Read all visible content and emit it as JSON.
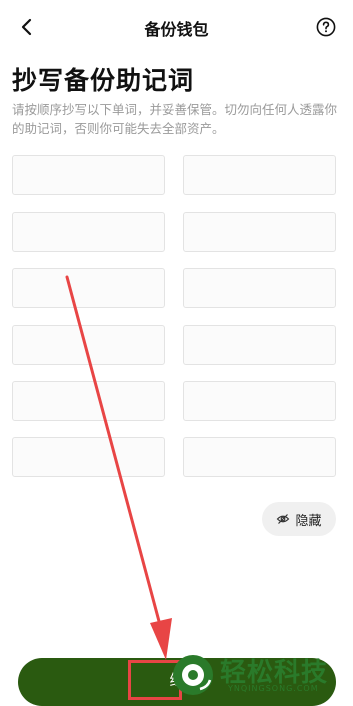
{
  "nav": {
    "title": "备份钱包"
  },
  "heading": "抄写备份助记词",
  "description": "请按顺序抄写以下单词，并妥善保管。切勿向任何人透露你的助记词，否则你可能失去全部资产。",
  "mnemonic_slots": [
    "",
    "",
    "",
    "",
    "",
    "",
    "",
    "",
    "",
    "",
    "",
    ""
  ],
  "hide_button": {
    "label": "隐藏",
    "icon": "eye-off-icon"
  },
  "continue_button": {
    "label": "继"
  },
  "annotation_color": "#e84545",
  "brand_color": "#2a5a10",
  "watermark": {
    "text": "轻松科技",
    "subtext": "YNQINGSONG.COM"
  }
}
